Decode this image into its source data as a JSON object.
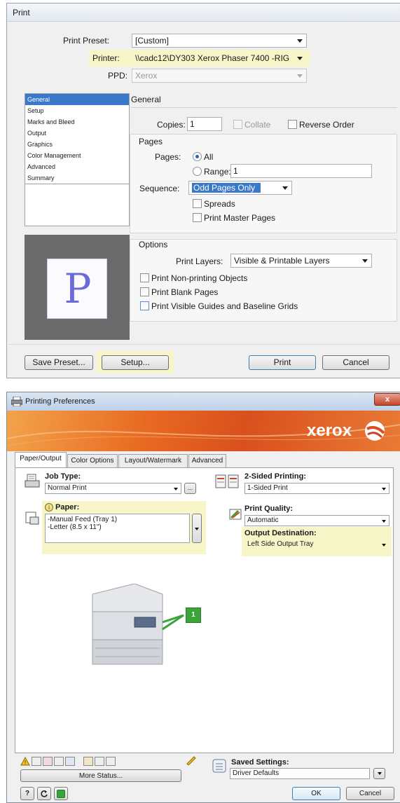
{
  "print": {
    "title": "Print",
    "preset_label": "Print Preset:",
    "preset_value": "[Custom]",
    "printer_label": "Printer:",
    "printer_value": "\\\\cadc12\\DY303 Xerox Phaser 7400 -RIG",
    "ppd_label": "PPD:",
    "ppd_value": "Xerox",
    "categories": [
      "General",
      "Setup",
      "Marks and Bleed",
      "Output",
      "Graphics",
      "Color Management",
      "Advanced",
      "Summary"
    ],
    "selected_category": "General",
    "section_title": "General",
    "copies_label": "Copies:",
    "copies_value": "1",
    "collate_label": "Collate",
    "reverse_order_label": "Reverse Order",
    "pages_group": "Pages",
    "pages_label": "Pages:",
    "all_label": "All",
    "range_label": "Range:",
    "range_value": "1",
    "sequence_label": "Sequence:",
    "sequence_value": "Odd Pages Only",
    "spreads_label": "Spreads",
    "print_master_pages_label": "Print Master Pages",
    "preview_letter": "P",
    "options_group": "Options",
    "print_layers_label": "Print Layers:",
    "print_layers_value": "Visible & Printable Layers",
    "non_printing_label": "Print Non-printing Objects",
    "blank_pages_label": "Print Blank Pages",
    "guides_label": "Print Visible Guides and Baseline Grids",
    "save_preset_button": "Save Preset...",
    "setup_button": "Setup...",
    "print_button": "Print",
    "cancel_button": "Cancel",
    "highlight_color": "#f6f6c8",
    "selected_color": "#3a78c9"
  },
  "prefs": {
    "title": "Printing Preferences",
    "close_glyph": "x",
    "brand": "xerox",
    "brand_color": "#e8501a",
    "tabs": [
      "Paper/Output",
      "Color Options",
      "Layout/Watermark",
      "Advanced"
    ],
    "active_tab": "Paper/Output",
    "job_type_label": "Job Type:",
    "job_type_value": "Normal Print",
    "job_type_more": "...",
    "two_sided_label": "2-Sided Printing:",
    "two_sided_value": "1-Sided Print",
    "paper_label": "Paper:",
    "paper_lines": [
      "-Manual Feed (Tray 1)",
      "-Letter (8.5 x 11\")"
    ],
    "print_quality_label": "Print Quality:",
    "print_quality_value": "Automatic",
    "output_destination_label": "Output Destination:",
    "output_destination_value": "Left Side Output Tray",
    "tray_badge": "1",
    "more_status_button": "More Status...",
    "saved_settings_label": "Saved Settings:",
    "saved_settings_value": "Driver Defaults",
    "help_button": "?",
    "ok_button": "OK",
    "cancel_button": "Cancel",
    "tray_green": "#3aa43a"
  }
}
